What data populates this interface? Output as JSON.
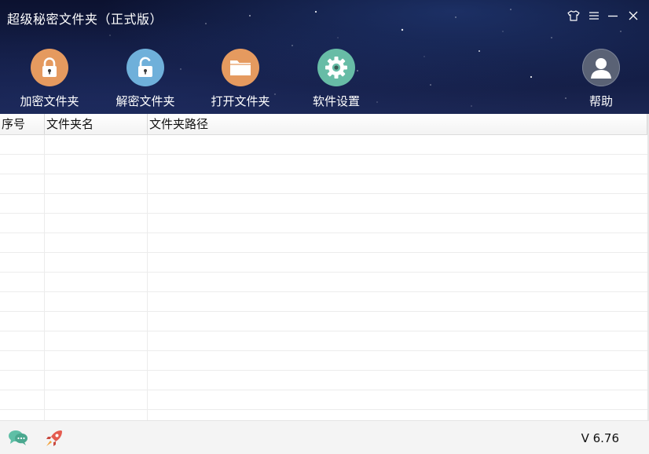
{
  "window": {
    "title": "超级秘密文件夹（正式版）"
  },
  "toolbar": [
    {
      "key": "encrypt",
      "label": "加密文件夹",
      "icon": "lock-closed-icon",
      "color": "#e59a5f"
    },
    {
      "key": "decrypt",
      "label": "解密文件夹",
      "icon": "lock-open-icon",
      "color": "#6fb0da"
    },
    {
      "key": "open",
      "label": "打开文件夹",
      "icon": "folder-icon",
      "color": "#e59a5f"
    },
    {
      "key": "settings",
      "label": "软件设置",
      "icon": "gear-icon",
      "color": "#67bca6"
    },
    {
      "key": "help",
      "label": "帮助",
      "icon": "user-avatar-icon",
      "color": "#5a6275"
    }
  ],
  "table": {
    "columns": [
      "序号",
      "文件夹名",
      "文件夹路径"
    ],
    "rows": []
  },
  "footer": {
    "version": "V 6.76"
  },
  "colors": {
    "header_bg": "#111a3f",
    "orange": "#e59a5f",
    "blue": "#6fb0da",
    "teal": "#67bca6",
    "chat_green": "#5fbfa6",
    "rocket_red": "#e45b4f"
  }
}
